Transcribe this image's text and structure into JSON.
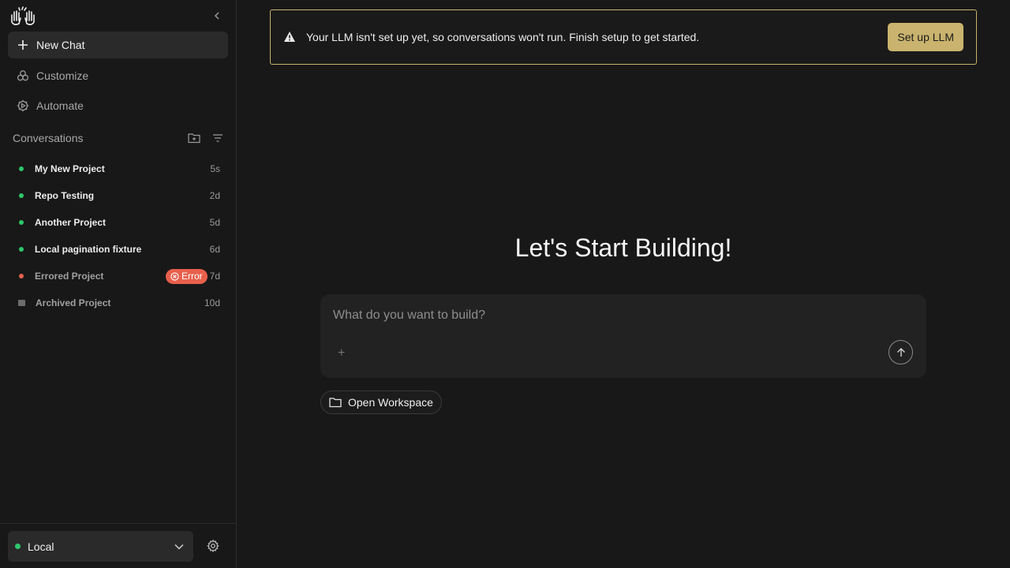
{
  "sidebar": {
    "nav": [
      {
        "label": "New Chat",
        "icon": "plus-icon"
      },
      {
        "label": "Customize",
        "icon": "customize-icon"
      },
      {
        "label": "Automate",
        "icon": "automate-icon"
      }
    ],
    "conversations_title": "Conversations",
    "conversations": [
      {
        "name": "My New Project",
        "time": "5s",
        "status": "active"
      },
      {
        "name": "Repo Testing",
        "time": "2d",
        "status": "active"
      },
      {
        "name": "Another Project",
        "time": "5d",
        "status": "active"
      },
      {
        "name": "Local pagination fixture",
        "time": "6d",
        "status": "active"
      },
      {
        "name": "Errored Project",
        "time": "7d",
        "status": "error",
        "badge": "Error"
      },
      {
        "name": "Archived Project",
        "time": "10d",
        "status": "archived"
      }
    ],
    "environment": "Local"
  },
  "banner": {
    "message": "Your LLM isn't set up yet, so conversations won't run. Finish setup to get started.",
    "button": "Set up LLM"
  },
  "main": {
    "heading": "Let's Start Building!",
    "composer_placeholder": "What do you want to build?",
    "open_workspace": "Open Workspace"
  },
  "colors": {
    "background": "#181818",
    "accent": "#c9b36e",
    "active_dot": "#2ec76b",
    "error": "#e8604c"
  }
}
